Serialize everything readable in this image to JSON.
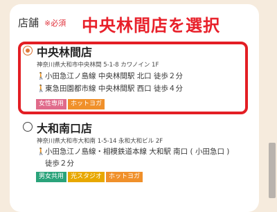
{
  "field": {
    "label": "店舗",
    "required": "※必須"
  },
  "annotation": "中央林間店を選択",
  "colors": {
    "pink": "#e06a8a",
    "orange": "#f0902a",
    "green": "#2aa37a",
    "gold": "#e8a800"
  },
  "stores": [
    {
      "name": "中央林間店",
      "selected": true,
      "address": "神奈川県大和市中央林間 5-1-8 カワノイン 1F",
      "access": [
        "小田急江ノ島線 中央林間駅 北口 徒歩２分",
        "東急田園都市線 中央林間駅 西口 徒歩４分"
      ],
      "tags": [
        "女性専用",
        "ホットヨガ"
      ]
    },
    {
      "name": "大和南口店",
      "selected": false,
      "address": "神奈川県大和市大和南 1-5-14 永和大和ビル 2F",
      "access": [
        "小田急江ノ島線・相模鉄道本線 大和駅 南口 ( 小田急口 )",
        "徒歩２分"
      ],
      "tags": [
        "男女共用",
        "光スタジオ",
        "ホットヨガ"
      ]
    }
  ]
}
